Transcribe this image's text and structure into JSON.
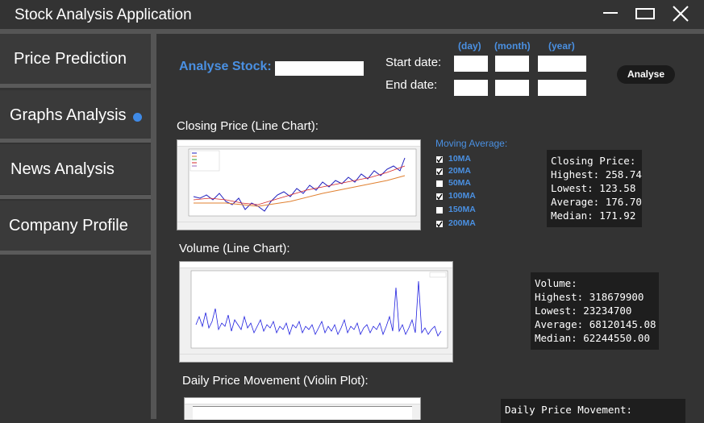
{
  "app": {
    "title": "Stock Analysis Application"
  },
  "window_controls": [
    "minimize-icon",
    "maximize-icon",
    "close-icon"
  ],
  "sidebar": {
    "items": [
      {
        "label": "Price Prediction",
        "active": false
      },
      {
        "label": "Graphs Analysis",
        "active": true
      },
      {
        "label": "News Analysis",
        "active": false
      },
      {
        "label": "Company Profile",
        "active": false
      }
    ]
  },
  "form": {
    "analyse_stock_label": "Analyse Stock:",
    "stock_value": "",
    "start_date_label": "Start date:",
    "end_date_label": "End date:",
    "day_label": "(day)",
    "month_label": "(month)",
    "year_label": "(year)",
    "start": {
      "day": "",
      "month": "",
      "year": ""
    },
    "end": {
      "day": "",
      "month": "",
      "year": ""
    },
    "analyse_button": "Analyse"
  },
  "closing": {
    "section_title": "Closing Price (Line Chart):",
    "stats": "Closing Price:\nHighest: 258.74\nLowest: 123.58\nAverage: 176.70\nMedian: 171.92"
  },
  "moving_average": {
    "title": "Moving Average:",
    "options": [
      {
        "label": "10MA",
        "checked": true
      },
      {
        "label": "20MA",
        "checked": true
      },
      {
        "label": "50MA",
        "checked": false
      },
      {
        "label": "100MA",
        "checked": true
      },
      {
        "label": "150MA",
        "checked": false
      },
      {
        "label": "200MA",
        "checked": true
      }
    ]
  },
  "volume": {
    "section_title": "Volume (Line Chart):",
    "stats": "Volume:\nHighest: 318679900\nLowest: 23234700\nAverage: 68120145.08\nMedian: 62244550.00"
  },
  "violin": {
    "section_title": "Daily Price Movement (Violin Plot):",
    "stats": "Daily Price Movement:"
  },
  "colors": {
    "accent": "#4a90e2",
    "background": "#333333",
    "stats_bg": "#1e1e1e",
    "closing_line": "#1f1fbf",
    "volume_line": "#1f1fdf"
  }
}
